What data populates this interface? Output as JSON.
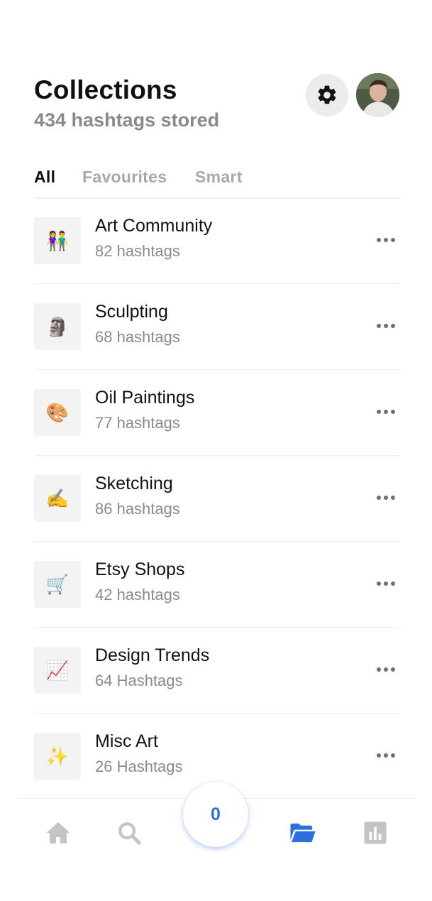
{
  "header": {
    "title": "Collections",
    "subtitle": "434 hashtags stored"
  },
  "tabs": [
    {
      "label": "All",
      "active": true
    },
    {
      "label": "Favourites",
      "active": false
    },
    {
      "label": "Smart",
      "active": false
    }
  ],
  "collections": [
    {
      "name": "Art Community",
      "count": "82 hashtags",
      "emoji": "👫"
    },
    {
      "name": "Sculpting",
      "count": "68 hashtags",
      "emoji": "🗿"
    },
    {
      "name": "Oil Paintings",
      "count": "77 hashtags",
      "emoji": "🎨"
    },
    {
      "name": "Sketching",
      "count": "86 hashtags",
      "emoji": "✍️"
    },
    {
      "name": "Etsy Shops",
      "count": "42 hashtags",
      "emoji": "🛒"
    },
    {
      "name": "Design Trends",
      "count": "64 Hashtags",
      "emoji": "📈"
    },
    {
      "name": "Misc Art",
      "count": "26 Hashtags",
      "emoji": "✨"
    }
  ],
  "bottom_nav": {
    "center_count": "0",
    "items": [
      "home-icon",
      "search-icon",
      "folder-icon",
      "stats-icon"
    ],
    "active_color": "#2f6fdc",
    "inactive_color": "#c4c4c4"
  }
}
